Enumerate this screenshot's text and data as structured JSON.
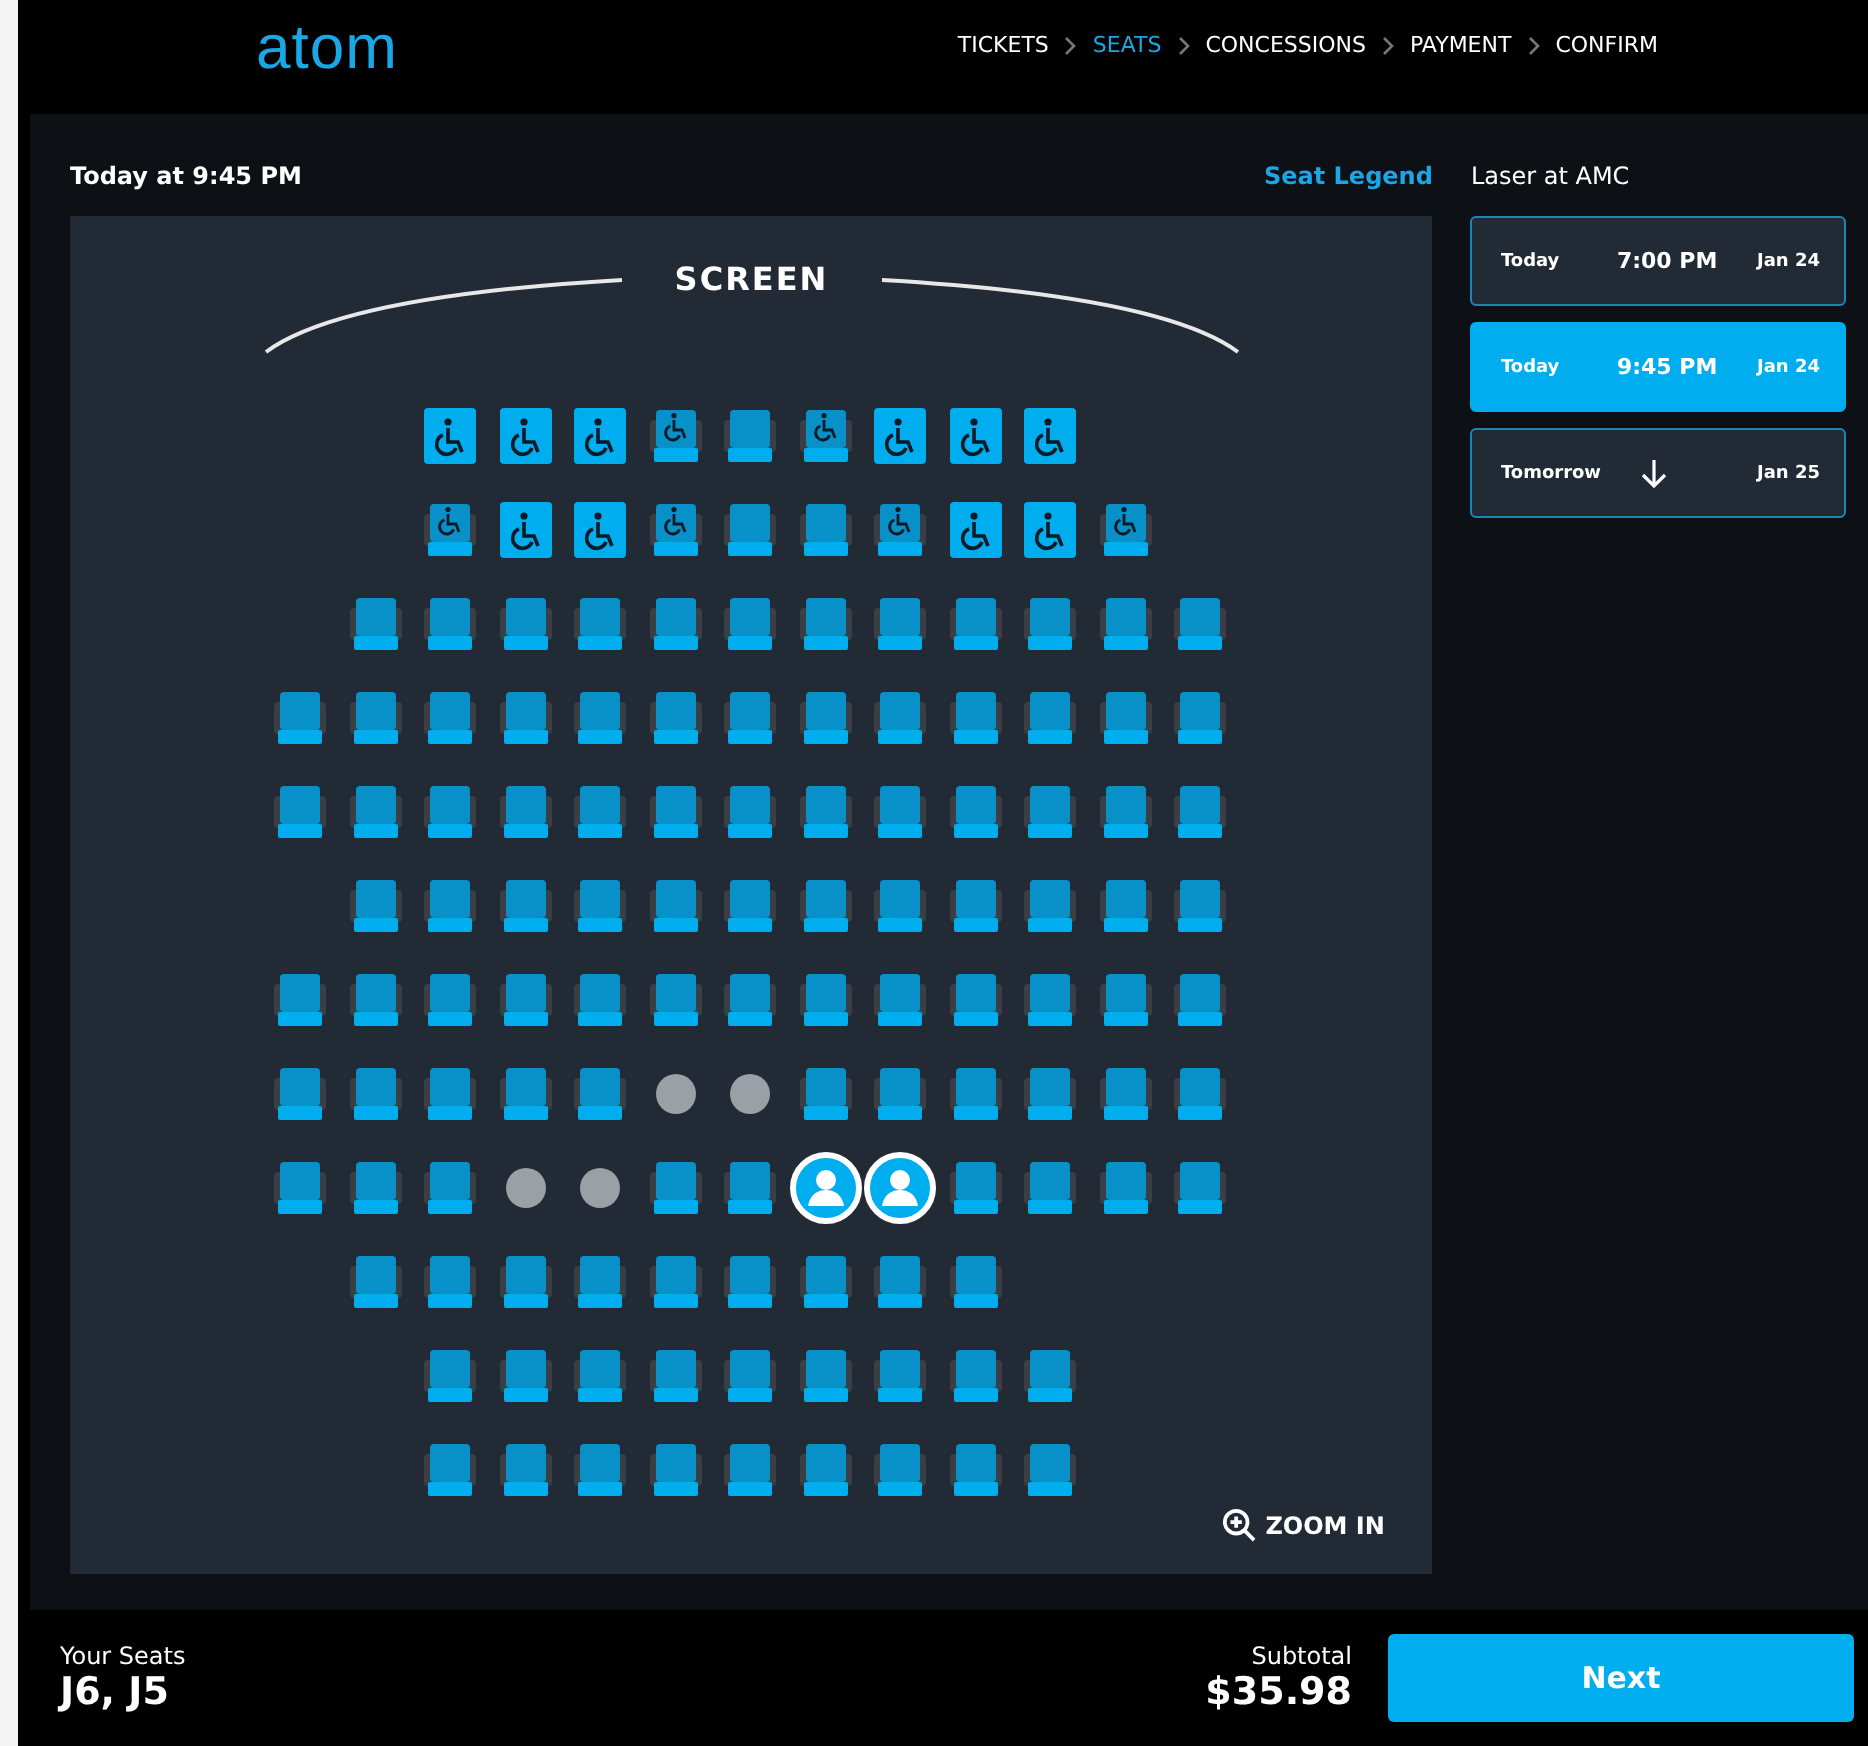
{
  "logo": "atom",
  "steps": [
    {
      "label": "TICKETS",
      "selected": false
    },
    {
      "label": "SEATS",
      "selected": true
    },
    {
      "label": "CONCESSIONS",
      "selected": false
    },
    {
      "label": "PAYMENT",
      "selected": false
    },
    {
      "label": "CONFIRM",
      "selected": false
    }
  ],
  "showing": "Today at 9:45 PM",
  "legend_link": "Seat Legend",
  "screen_label": "SCREEN",
  "seat_rows": [
    [
      {
        "kind": "gap"
      },
      {
        "kind": "gap"
      },
      {
        "kind": "wheelchair"
      },
      {
        "kind": "wheelchair"
      },
      {
        "kind": "wheelchair"
      },
      {
        "kind": "companion"
      },
      {
        "kind": "standard"
      },
      {
        "kind": "companion"
      },
      {
        "kind": "wheelchair"
      },
      {
        "kind": "wheelchair"
      },
      {
        "kind": "wheelchair"
      }
    ],
    [
      {
        "kind": "gap"
      },
      {
        "kind": "gap"
      },
      {
        "kind": "companion"
      },
      {
        "kind": "wheelchair"
      },
      {
        "kind": "wheelchair"
      },
      {
        "kind": "companion"
      },
      {
        "kind": "standard"
      },
      {
        "kind": "standard"
      },
      {
        "kind": "companion"
      },
      {
        "kind": "wheelchair"
      },
      {
        "kind": "wheelchair"
      },
      {
        "kind": "companion"
      }
    ],
    [
      {
        "kind": "gap"
      },
      {
        "kind": "standard"
      },
      {
        "kind": "standard"
      },
      {
        "kind": "standard"
      },
      {
        "kind": "standard"
      },
      {
        "kind": "standard"
      },
      {
        "kind": "standard"
      },
      {
        "kind": "standard"
      },
      {
        "kind": "standard"
      },
      {
        "kind": "standard"
      },
      {
        "kind": "standard"
      },
      {
        "kind": "standard"
      },
      {
        "kind": "standard"
      }
    ],
    [
      {
        "kind": "standard"
      },
      {
        "kind": "standard"
      },
      {
        "kind": "standard"
      },
      {
        "kind": "standard"
      },
      {
        "kind": "standard"
      },
      {
        "kind": "standard"
      },
      {
        "kind": "standard"
      },
      {
        "kind": "standard"
      },
      {
        "kind": "standard"
      },
      {
        "kind": "standard"
      },
      {
        "kind": "standard"
      },
      {
        "kind": "standard"
      },
      {
        "kind": "standard"
      }
    ],
    [
      {
        "kind": "standard"
      },
      {
        "kind": "standard"
      },
      {
        "kind": "standard"
      },
      {
        "kind": "standard"
      },
      {
        "kind": "standard"
      },
      {
        "kind": "standard"
      },
      {
        "kind": "standard"
      },
      {
        "kind": "standard"
      },
      {
        "kind": "standard"
      },
      {
        "kind": "standard"
      },
      {
        "kind": "standard"
      },
      {
        "kind": "standard"
      },
      {
        "kind": "standard"
      }
    ],
    [
      {
        "kind": "gap"
      },
      {
        "kind": "standard"
      },
      {
        "kind": "standard"
      },
      {
        "kind": "standard"
      },
      {
        "kind": "standard"
      },
      {
        "kind": "standard"
      },
      {
        "kind": "standard"
      },
      {
        "kind": "standard"
      },
      {
        "kind": "standard"
      },
      {
        "kind": "standard"
      },
      {
        "kind": "standard"
      },
      {
        "kind": "standard"
      },
      {
        "kind": "standard"
      }
    ],
    [
      {
        "kind": "standard"
      },
      {
        "kind": "standard"
      },
      {
        "kind": "standard"
      },
      {
        "kind": "standard"
      },
      {
        "kind": "standard"
      },
      {
        "kind": "standard"
      },
      {
        "kind": "standard"
      },
      {
        "kind": "standard"
      },
      {
        "kind": "standard"
      },
      {
        "kind": "standard"
      },
      {
        "kind": "standard"
      },
      {
        "kind": "standard"
      },
      {
        "kind": "standard"
      }
    ],
    [
      {
        "kind": "standard"
      },
      {
        "kind": "standard"
      },
      {
        "kind": "standard"
      },
      {
        "kind": "standard"
      },
      {
        "kind": "standard"
      },
      {
        "kind": "taken"
      },
      {
        "kind": "taken"
      },
      {
        "kind": "standard"
      },
      {
        "kind": "standard"
      },
      {
        "kind": "standard"
      },
      {
        "kind": "standard"
      },
      {
        "kind": "standard"
      },
      {
        "kind": "standard"
      }
    ],
    [
      {
        "kind": "standard"
      },
      {
        "kind": "standard"
      },
      {
        "kind": "standard"
      },
      {
        "kind": "taken"
      },
      {
        "kind": "taken"
      },
      {
        "kind": "standard"
      },
      {
        "kind": "standard"
      },
      {
        "kind": "selected"
      },
      {
        "kind": "selected"
      },
      {
        "kind": "standard"
      },
      {
        "kind": "standard"
      },
      {
        "kind": "standard"
      },
      {
        "kind": "standard"
      }
    ],
    [
      {
        "kind": "gap"
      },
      {
        "kind": "standard"
      },
      {
        "kind": "standard"
      },
      {
        "kind": "standard"
      },
      {
        "kind": "standard"
      },
      {
        "kind": "standard"
      },
      {
        "kind": "standard"
      },
      {
        "kind": "standard"
      },
      {
        "kind": "standard"
      },
      {
        "kind": "standard"
      }
    ],
    [
      {
        "kind": "gap"
      },
      {
        "kind": "gap"
      },
      {
        "kind": "standard"
      },
      {
        "kind": "standard"
      },
      {
        "kind": "standard"
      },
      {
        "kind": "standard"
      },
      {
        "kind": "standard"
      },
      {
        "kind": "standard"
      },
      {
        "kind": "standard"
      },
      {
        "kind": "standard"
      },
      {
        "kind": "standard"
      }
    ],
    [
      {
        "kind": "gap"
      },
      {
        "kind": "gap"
      },
      {
        "kind": "standard"
      },
      {
        "kind": "standard"
      },
      {
        "kind": "standard"
      },
      {
        "kind": "standard"
      },
      {
        "kind": "standard"
      },
      {
        "kind": "standard"
      },
      {
        "kind": "standard"
      },
      {
        "kind": "standard"
      },
      {
        "kind": "standard"
      }
    ]
  ],
  "zoom_label": "ZOOM IN",
  "venue": "Laser at AMC",
  "showtimes": [
    {
      "day": "Today",
      "time": "7:00 PM",
      "date": "Jan 24",
      "selected": false
    },
    {
      "day": "Today",
      "time": "9:45 PM",
      "date": "Jan 24",
      "selected": true
    },
    {
      "day": "Tomorrow",
      "date": "Jan 25",
      "selected": false
    }
  ],
  "footer": {
    "seats_label": "Your Seats",
    "seats": "J6, J5",
    "subtotal_label": "Subtotal",
    "subtotal": "$35.98",
    "next": "Next"
  }
}
